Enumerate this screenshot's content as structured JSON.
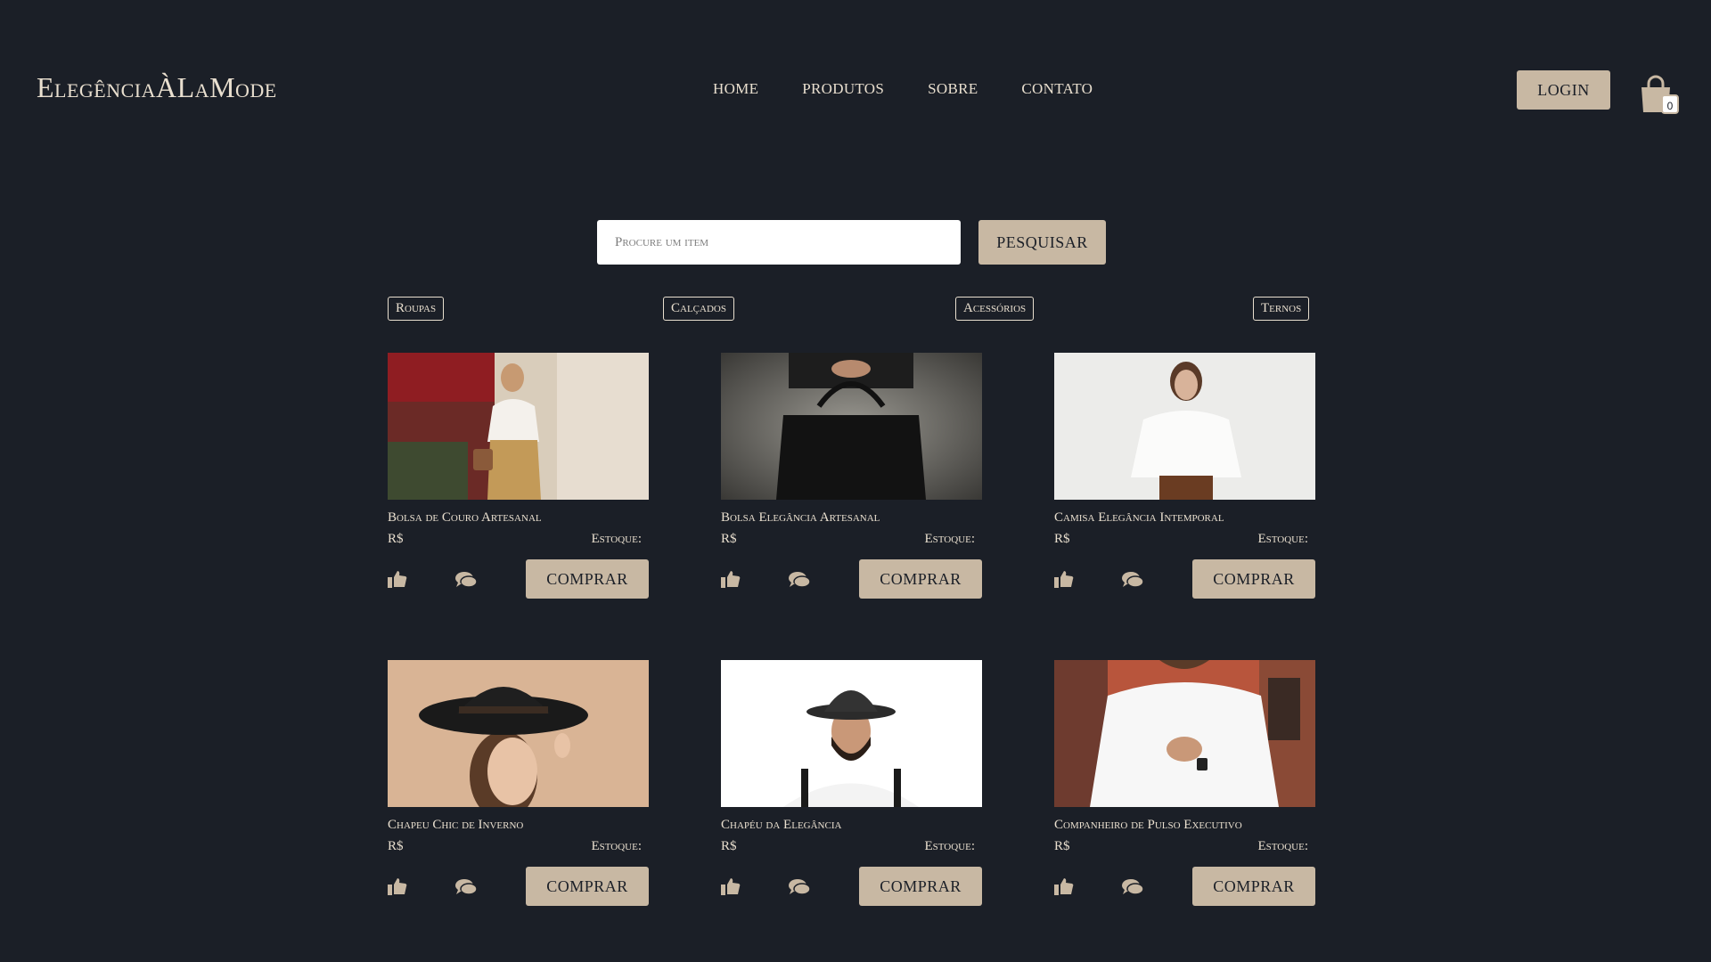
{
  "brand": {
    "logo": "ElegênciaÀLaMode"
  },
  "nav": {
    "items": [
      "HOME",
      "PRODUTOS",
      "SOBRE",
      "CONTATO"
    ]
  },
  "header": {
    "login_label": "LOGIN",
    "cart_count": "0"
  },
  "search": {
    "placeholder": "Procure um item",
    "button_label": "PESQUISAR"
  },
  "categories": [
    "Roupas",
    "Calçados",
    "Acessórios",
    "Ternos"
  ],
  "products": [
    {
      "name": "Bolsa de Couro Artesanal",
      "price_label": "R$",
      "stock_label": "Estoque:",
      "buy_label": "COMPRAR"
    },
    {
      "name": "Bolsa Elegância Artesanal",
      "price_label": "R$",
      "stock_label": "Estoque:",
      "buy_label": "COMPRAR"
    },
    {
      "name": "Camisa Elegância Intemporal",
      "price_label": "R$",
      "stock_label": "Estoque:",
      "buy_label": "COMPRAR"
    },
    {
      "name": "Chapeu Chic de Inverno",
      "price_label": "R$",
      "stock_label": "Estoque:",
      "buy_label": "COMPRAR"
    },
    {
      "name": "Chapéu da Elegância",
      "price_label": "R$",
      "stock_label": "Estoque:",
      "buy_label": "COMPRAR"
    },
    {
      "name": "Companheiro de Pulso Executivo",
      "price_label": "R$",
      "stock_label": "Estoque:",
      "buy_label": "COMPRAR"
    }
  ],
  "icons": {
    "cart": "shopping-bag-icon",
    "like": "thumbs-up-icon",
    "comment": "comments-icon"
  },
  "colors": {
    "background": "#1b1f27",
    "accent": "#c8b8a3",
    "text": "#e9dfcf"
  }
}
